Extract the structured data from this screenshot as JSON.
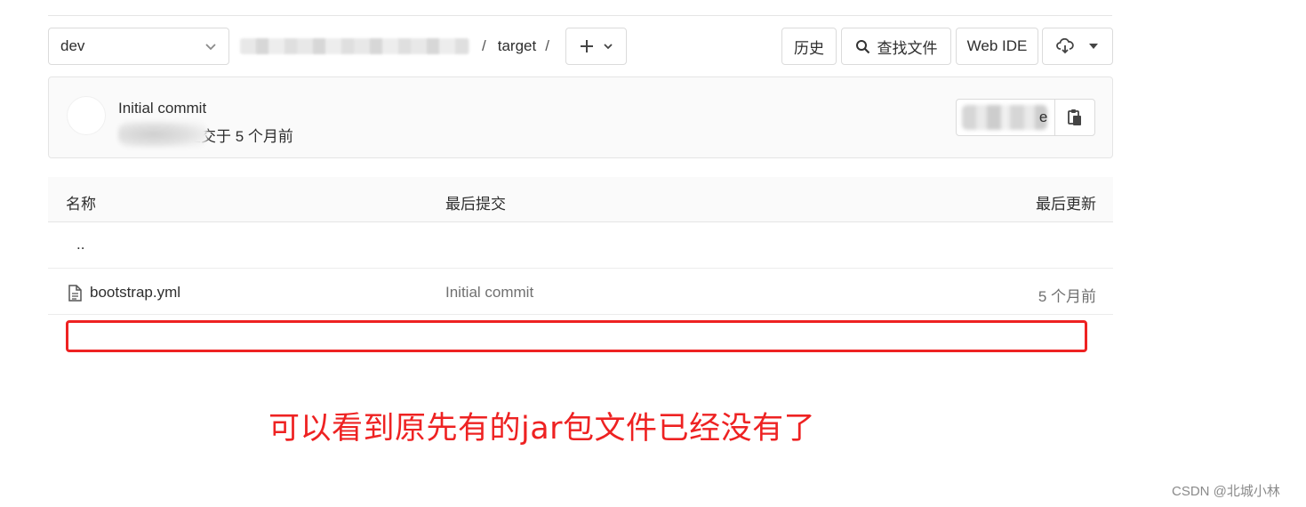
{
  "toolbar": {
    "branch": "dev",
    "path_sep": "/",
    "path_folder": "target",
    "history_label": "历史",
    "find_file_label": "查找文件",
    "web_ide_label": "Web IDE"
  },
  "commit": {
    "title": "Initial commit",
    "authored_text": "提交于 5 个月前",
    "sha_suffix": "e"
  },
  "table": {
    "headers": {
      "name": "名称",
      "last_commit": "最后提交",
      "last_update": "最后更新"
    },
    "parent_dir": "..",
    "rows": [
      {
        "name": "bootstrap.yml",
        "commit": "Initial commit",
        "updated": "5 个月前"
      }
    ]
  },
  "annotation": {
    "text": "可以看到原先有的jar包文件已经没有了",
    "color": "#ee2222"
  },
  "watermark": "CSDN @北城小林",
  "colors": {
    "border": "#dbdbdb",
    "header_bg": "#fafafa",
    "muted_text": "#707070",
    "annotation_red": "#ee2222"
  }
}
